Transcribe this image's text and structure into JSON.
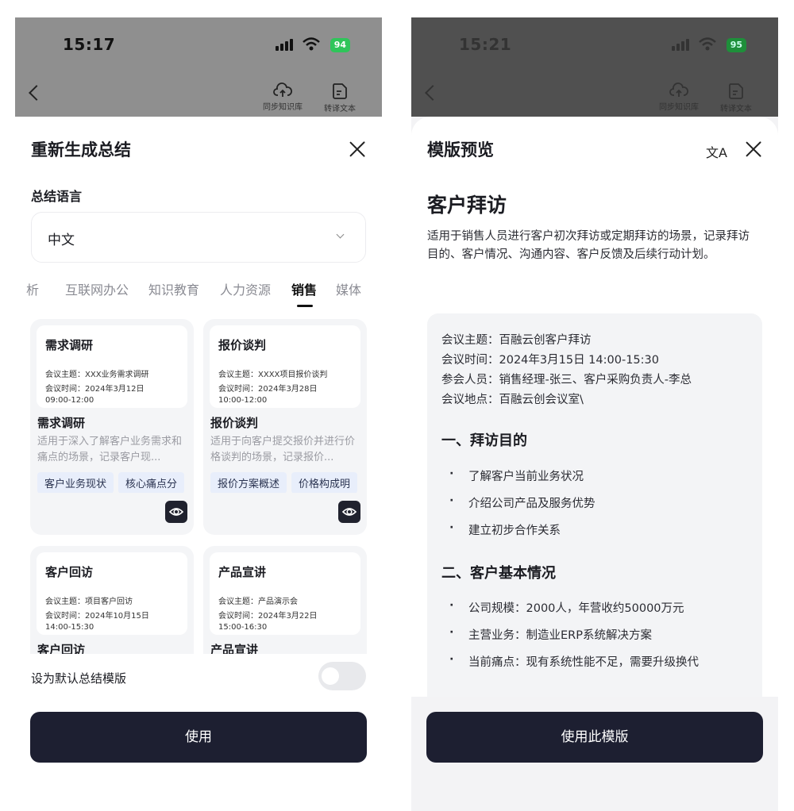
{
  "left": {
    "status": {
      "time": "15:17",
      "battery": "94"
    },
    "header_tools": [
      {
        "label": "同步知识库",
        "icon": "cloud-upload-icon"
      },
      {
        "label": "转译文本",
        "icon": "document-icon"
      }
    ],
    "sheet_title": "重新生成总结",
    "language_label": "总结语言",
    "language_value": "中文",
    "categories": [
      "析",
      "互联网办公",
      "知识教育",
      "人力资源",
      "销售",
      "媒体"
    ],
    "active_category": "销售",
    "templates": [
      {
        "thumb_title": "需求调研",
        "thumb_lines": [
          "会议主题：XXX业务需求调研",
          "会议时间：2024年3月12日",
          "09:00-12:00"
        ],
        "name": "需求调研",
        "desc": "适用于深入了解客户业务需求和痛点的场景，记录客户现...",
        "tags": [
          "客户业务现状",
          "核心痛点分"
        ]
      },
      {
        "thumb_title": "报价谈判",
        "thumb_lines": [
          "会议主题：XXXX项目报价谈判",
          "会议时间：2024年3月28日",
          "10:00-12:00"
        ],
        "name": "报价谈判",
        "desc": "适用于向客户提交报价并进行价格谈判的场景，记录报价...",
        "tags": [
          "报价方案概述",
          "价格构成明"
        ]
      },
      {
        "thumb_title": "客户回访",
        "thumb_lines": [
          "会议主题：项目客户回访",
          "会议时间：2024年10月15日",
          "14:00-15:30"
        ],
        "name": "客户回访",
        "desc": "",
        "tags": []
      },
      {
        "thumb_title": "产品宣讲",
        "thumb_lines": [
          "会议主题：产品演示会",
          "会议时间：2024年3月22日",
          "15:00-16:30"
        ],
        "name": "产品宣讲",
        "desc": "",
        "tags": []
      }
    ],
    "default_label": "设为默认总结模版",
    "use_button": "使用"
  },
  "right": {
    "status": {
      "time": "15:21",
      "battery": "95"
    },
    "header_tools": [
      {
        "label": "同步知识库",
        "icon": "cloud-upload-icon"
      },
      {
        "label": "转译文本",
        "icon": "document-icon"
      }
    ],
    "sheet_title": "模版预览",
    "template_title": "客户拜访",
    "template_desc": "适用于销售人员进行客户初次拜访或定期拜访的场景，记录拜访目的、客户情况、沟通内容、客户反馈及后续行动计划。",
    "meta": [
      "会议主题：百融云创客户拜访",
      "会议时间：2024年3月15日 14:00-15:30",
      "参会人员：销售经理-张三、客户采购负责人-李总",
      "会议地点：百融云创会议室\\"
    ],
    "sections": [
      {
        "heading": "一、拜访目的",
        "bullets": [
          "了解客户当前业务状况",
          "介绍公司产品及服务优势",
          "建立初步合作关系"
        ]
      },
      {
        "heading": "二、客户基本情况",
        "bullets": [
          "公司规模：2000人，年营收约50000万元",
          "主营业务：制造业ERP系统解决方案",
          "当前痛点：现有系统性能不足，需要升级换代"
        ]
      }
    ],
    "use_button": "使用此模版"
  }
}
